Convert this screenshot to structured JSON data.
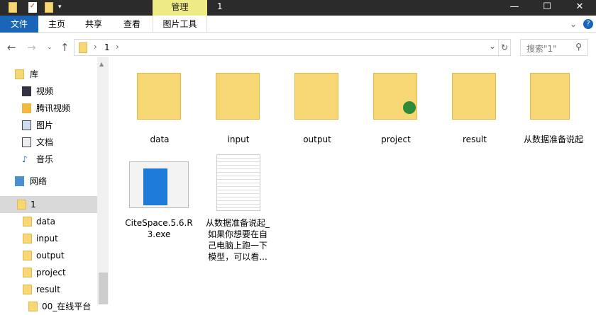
{
  "titlebar": {
    "title": "1",
    "context_tab": "管理",
    "minimize": "—",
    "maximize": "☐",
    "close": "✕"
  },
  "ribbon": {
    "tabs": [
      "文件",
      "主页",
      "共享",
      "查看",
      "图片工具"
    ],
    "expand": "⌄",
    "help": "?"
  },
  "address": {
    "path": [
      "1"
    ],
    "search_placeholder": "搜索\"1\""
  },
  "nav_pane": {
    "items": [
      {
        "label": "库",
        "icon": "library-icon"
      },
      {
        "label": "视频",
        "icon": "video-icon"
      },
      {
        "label": "腾讯视频",
        "icon": "tencent-video-icon"
      },
      {
        "label": "图片",
        "icon": "pictures-icon"
      },
      {
        "label": "文档",
        "icon": "documents-icon"
      },
      {
        "label": "音乐",
        "icon": "music-icon"
      },
      {
        "label": "网络",
        "icon": "network-icon"
      },
      {
        "label": "1",
        "icon": "folder-icon",
        "selected": true
      },
      {
        "label": "data",
        "icon": "folder-icon"
      },
      {
        "label": "input",
        "icon": "folder-icon"
      },
      {
        "label": "output",
        "icon": "folder-icon"
      },
      {
        "label": "project",
        "icon": "folder-icon"
      },
      {
        "label": "result",
        "icon": "folder-icon"
      },
      {
        "label": "00_在线平台",
        "icon": "folder-icon"
      }
    ]
  },
  "files": [
    {
      "name": "data",
      "type": "folder"
    },
    {
      "name": "input",
      "type": "folder"
    },
    {
      "name": "output",
      "type": "folder"
    },
    {
      "name": "project",
      "type": "folder"
    },
    {
      "name": "result",
      "type": "folder"
    },
    {
      "name": "从数据准备说起",
      "type": "folder"
    },
    {
      "name": "CiteSpace.5.6.R3.exe",
      "type": "exe",
      "lines": [
        "CiteSpace.5.6.R",
        "3.exe"
      ]
    },
    {
      "name": "从数据准备说起_如果你想要在自己电脑上跑一下模型，可以看...",
      "type": "text",
      "lines": [
        "从数据准备说起_",
        "如果你想要在自",
        "己电脑上跑一下",
        "模型，可以看..."
      ]
    }
  ]
}
